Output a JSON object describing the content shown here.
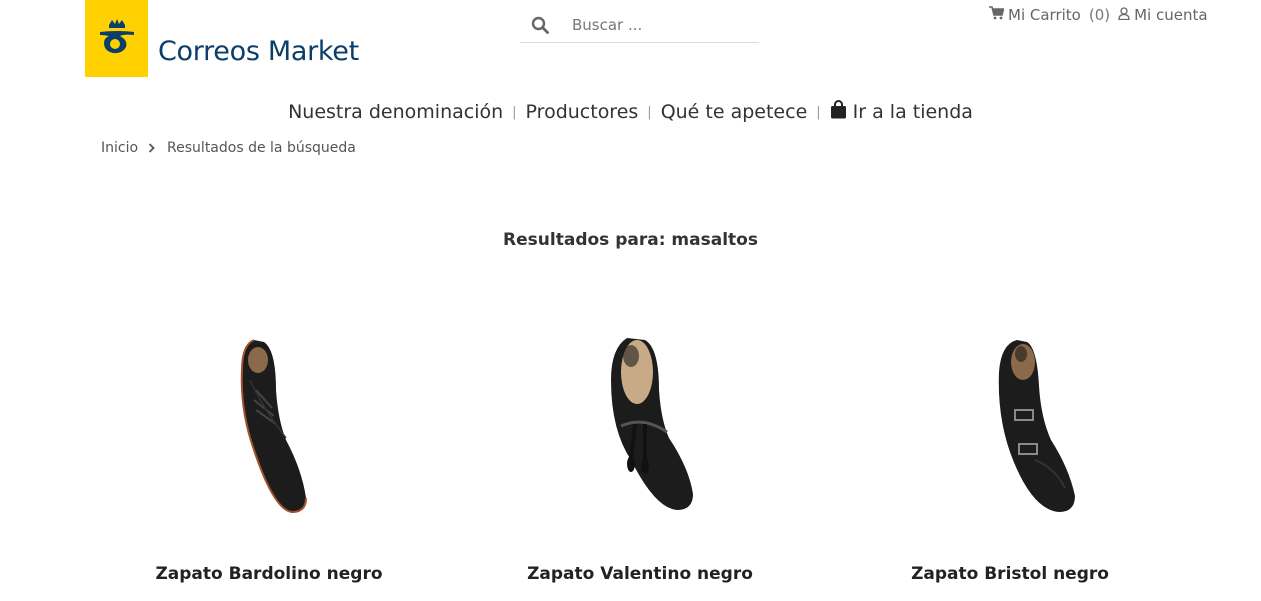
{
  "header": {
    "logo_text": "Correos Market",
    "search_placeholder": "Buscar ...",
    "cart_label": "Mi Carrito",
    "cart_count": "(0)",
    "account_label": "Mi cuenta"
  },
  "nav": {
    "items": [
      {
        "label": "Nuestra denominación"
      },
      {
        "label": "Productores"
      },
      {
        "label": "Qué te apetece"
      },
      {
        "label": "Ir a la tienda",
        "icon": "shopping-bag-icon"
      }
    ]
  },
  "breadcrumb": {
    "home": "Inicio",
    "current": "Resultados de la búsqueda"
  },
  "results": {
    "title": "Resultados para: masaltos"
  },
  "products": [
    {
      "name": "Zapato Bardolino negro",
      "image": "derby-shoe-black"
    },
    {
      "name": "Zapato Valentino negro",
      "image": "tassel-loafer-black"
    },
    {
      "name": "Zapato Bristol negro",
      "image": "double-monk-shoe-black"
    }
  ],
  "colors": {
    "brand_yellow": "#ffd100",
    "brand_blue": "#0b3e6b"
  }
}
